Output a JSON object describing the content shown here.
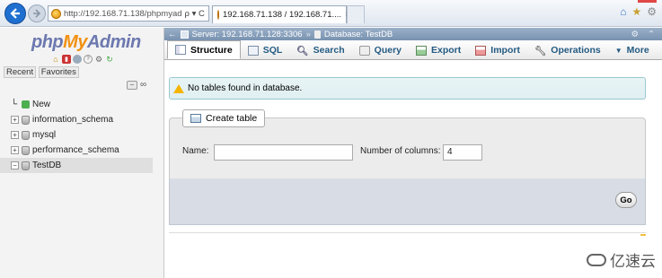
{
  "browser": {
    "address": "http://192.168.71.138/phpmyad",
    "address_controls": "ρ ▾ C",
    "tab_title": "192.168.71.138 / 192.168.71....",
    "tab_close": "×"
  },
  "sidebar": {
    "logo_php": "php",
    "logo_my": "My",
    "logo_admin": "Admin",
    "recent": "Recent",
    "favorites": "Favorites",
    "collapse": "−",
    "link": "∞",
    "tree": [
      {
        "label": "New",
        "type": "new"
      },
      {
        "label": "information_schema",
        "type": "db",
        "expander": "+"
      },
      {
        "label": "mysql",
        "type": "db",
        "expander": "+"
      },
      {
        "label": "performance_schema",
        "type": "db",
        "expander": "+"
      },
      {
        "label": "TestDB",
        "type": "db",
        "expander": "−",
        "selected": true
      }
    ]
  },
  "breadcrumb": {
    "server": "Server: 192.168.71.128:3306",
    "sep": "»",
    "database": "Database: TestDB",
    "gear": "⚙",
    "collapse": "⌃"
  },
  "tabs": [
    {
      "label": "Structure",
      "active": true
    },
    {
      "label": "SQL"
    },
    {
      "label": "Search"
    },
    {
      "label": "Query"
    },
    {
      "label": "Export"
    },
    {
      "label": "Import"
    },
    {
      "label": "Operations"
    },
    {
      "label": "More",
      "prefix": "▼"
    }
  ],
  "notice": "No tables found in database.",
  "create_table": {
    "legend": "Create table",
    "name_label": "Name:",
    "name_value": "",
    "columns_label": "Number of columns:",
    "columns_value": "4",
    "go": "Go"
  },
  "watermark": "亿速云",
  "colors": {
    "accent": "#235a81",
    "logo_orange": "#f29111",
    "logo_blue": "#6c78af"
  }
}
